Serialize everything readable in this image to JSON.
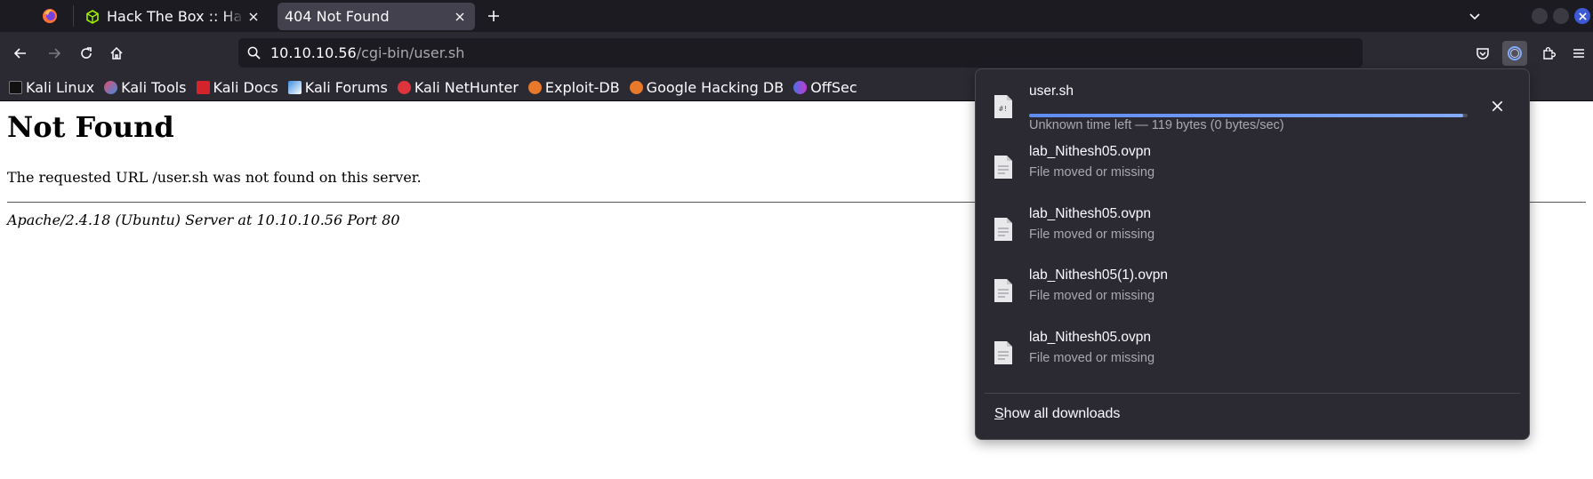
{
  "tabs": [
    {
      "title": "Hack The Box :: Hack The Box",
      "icon": "hackthebox-cube-icon",
      "active": false
    },
    {
      "title": "404 Not Found",
      "active": true
    }
  ],
  "urlbar": {
    "host": "10.10.10.56",
    "path": "/cgi-bin/user.sh"
  },
  "bookmarks": [
    {
      "label": "Kali Linux",
      "icon": "kali-dragon-icon",
      "color": "#1a1a1a"
    },
    {
      "label": "Kali Tools",
      "icon": "kali-tools-icon",
      "color": "#e34b6c"
    },
    {
      "label": "Kali Docs",
      "icon": "kali-docs-icon",
      "color": "#d4232b"
    },
    {
      "label": "Kali Forums",
      "icon": "kali-forums-icon",
      "color": "#3f8ee0"
    },
    {
      "label": "Kali NetHunter",
      "icon": "nethunter-icon",
      "color": "#e0343c"
    },
    {
      "label": "Exploit-DB",
      "icon": "exploit-db-icon",
      "color": "#e8782a"
    },
    {
      "label": "Google Hacking DB",
      "icon": "ghdb-icon",
      "color": "#e8782a"
    },
    {
      "label": "OffSec",
      "icon": "offsec-icon",
      "color": "#4b6fe0"
    }
  ],
  "page": {
    "heading": "Not Found",
    "message": "The requested URL /user.sh was not found on this server.",
    "server_signature": "Apache/2.4.18 (Ubuntu) Server at 10.10.10.56 Port 80"
  },
  "downloads": {
    "items": [
      {
        "name": "user.sh",
        "status": "Unknown time left — 119 bytes (0 bytes/sec)",
        "in_progress": true,
        "progress_fraction": 0.99,
        "icon": "script-file-icon"
      },
      {
        "name": "lab_Nithesh05.ovpn",
        "status": "File moved or missing",
        "icon": "document-file-icon"
      },
      {
        "name": "lab_Nithesh05.ovpn",
        "status": "File moved or missing",
        "icon": "document-file-icon"
      },
      {
        "name": "lab_Nithesh05(1).ovpn",
        "status": "File moved or missing",
        "icon": "document-file-icon"
      },
      {
        "name": "lab_Nithesh05.ovpn",
        "status": "File moved or missing",
        "icon": "document-file-icon"
      }
    ],
    "show_all_mnemonic": "S",
    "show_all_rest": "how all downloads"
  },
  "colors": {
    "tabbar_bg": "#1c1b22",
    "toolbar_bg": "#2b2a33",
    "active_tab_bg": "#42414d",
    "progress_accent": "#82aaff"
  }
}
